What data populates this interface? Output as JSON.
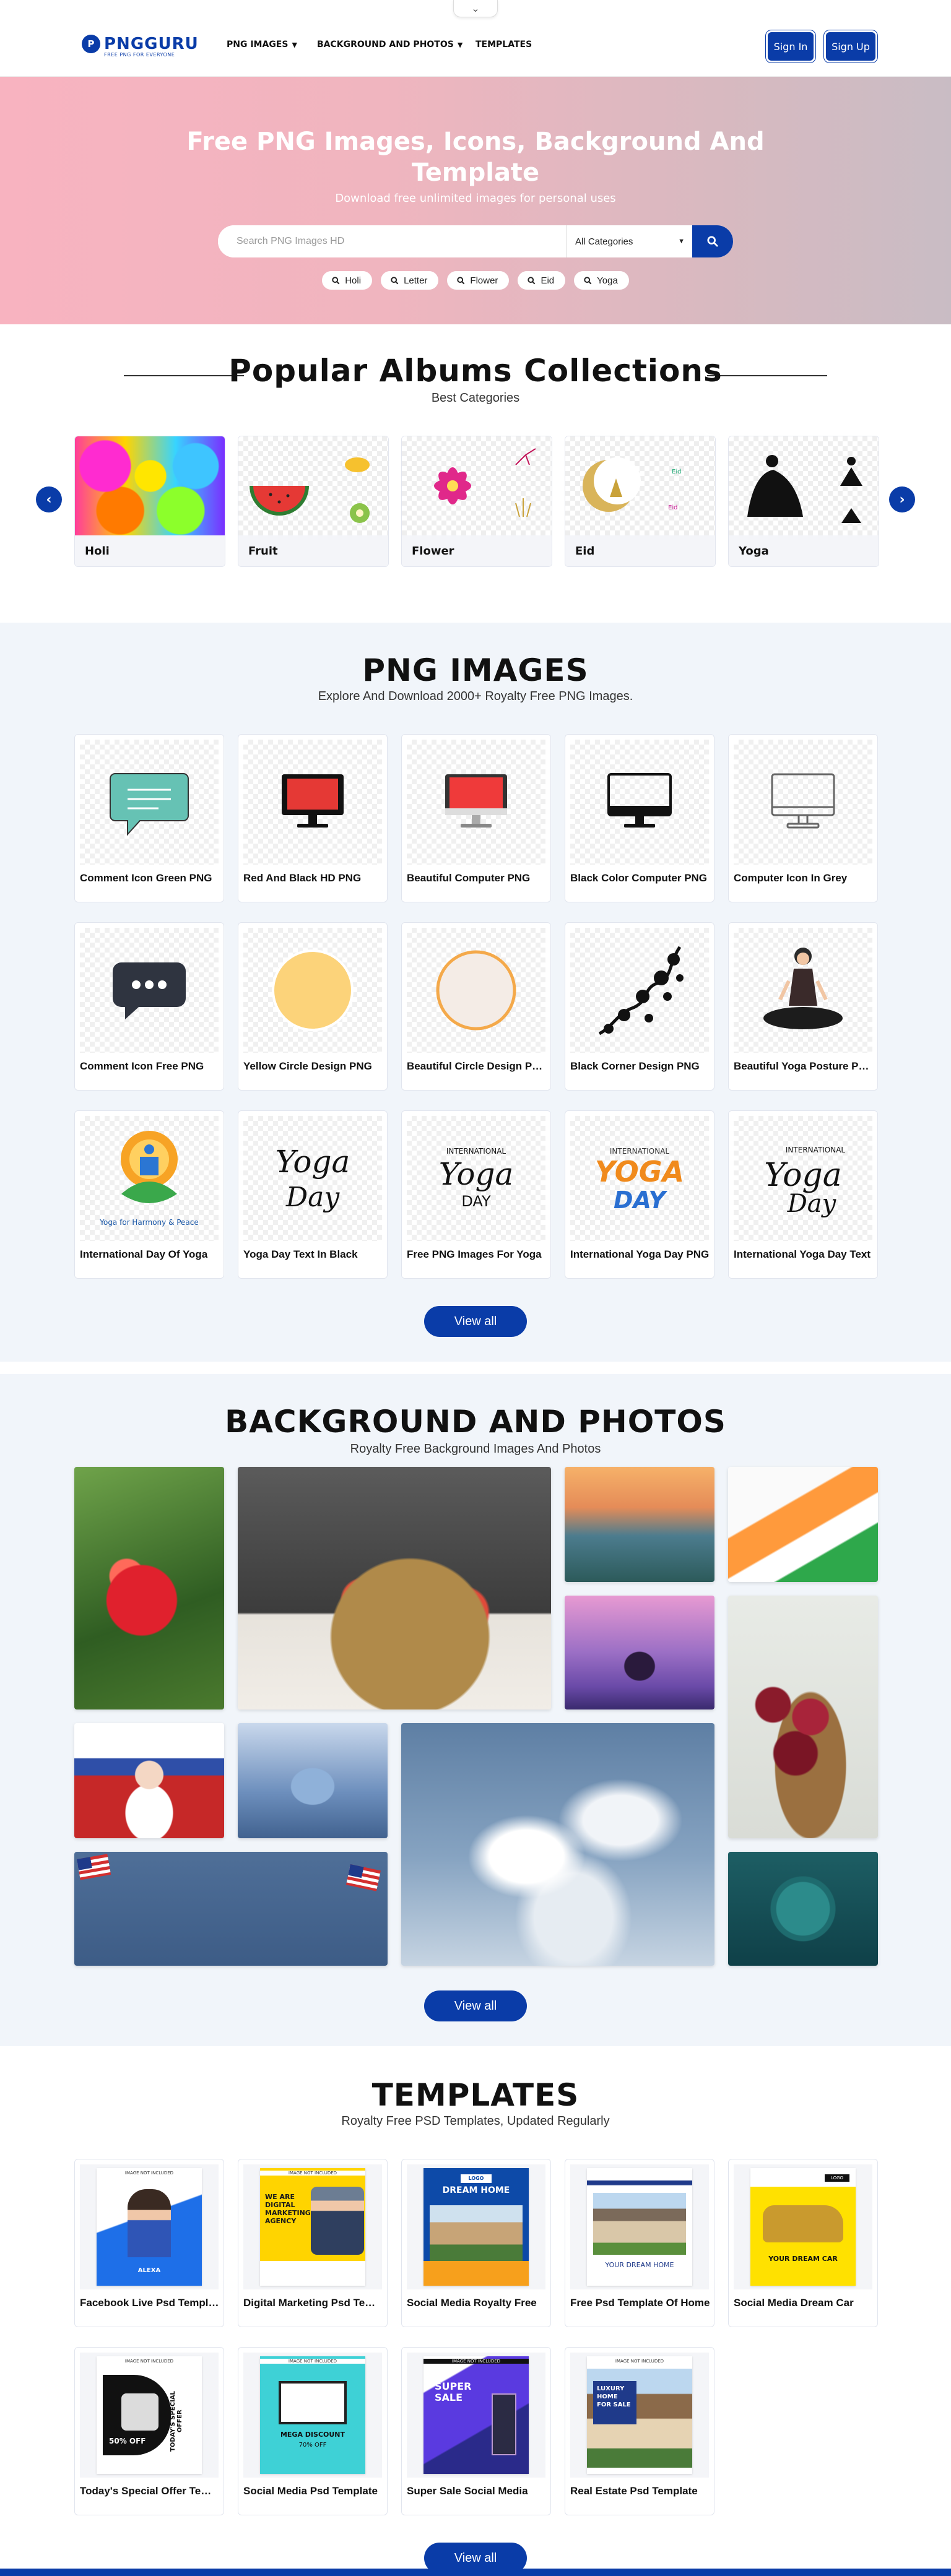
{
  "header": {
    "logo_text": "PNGGURU",
    "logo_mark": "P",
    "logo_tagline": "FREE PNG FOR EVERYONE",
    "nav": [
      {
        "label": "PNG IMAGES",
        "dropdown": true
      },
      {
        "label": "BACKGROUND AND PHOTOS",
        "dropdown": true
      },
      {
        "label": "TEMPLATES",
        "dropdown": false
      }
    ],
    "sign_in": "Sign In",
    "sign_up": "Sign Up"
  },
  "hero": {
    "title": "Free PNG Images, Icons, Background And Template",
    "subtitle": "Download free unlimited images for personal uses",
    "search_placeholder": "Search PNG Images HD",
    "category_selected": "All Categories",
    "chips": [
      "Holi",
      "Letter",
      "Flower",
      "Eid",
      "Yoga"
    ]
  },
  "albums": {
    "title": "Popular Albums Collections",
    "subtitle": "Best Categories",
    "items": [
      "Holi",
      "Fruit",
      "Flower",
      "Eid",
      "Yoga"
    ]
  },
  "png_images": {
    "title": "PNG IMAGES",
    "subtitle": "Explore And Download 2000+ Royalty Free PNG Images.",
    "items": [
      "Comment Icon Green PNG",
      "Red And Black HD PNG",
      "Beautiful Computer PNG",
      "Black Color Computer PNG",
      "Computer Icon In Grey",
      "Comment Icon Free PNG",
      "Yellow Circle Design PNG",
      "Beautiful Circle Design PNG",
      "Black Corner Design PNG",
      "Beautiful Yoga Posture PNG",
      "International Day Of Yoga",
      "Yoga Day Text In Black",
      "Free PNG Images For Yoga",
      "International Yoga Day PNG",
      "International Yoga Day Text"
    ],
    "view_all": "View all"
  },
  "backgrounds": {
    "title": "BACKGROUND AND PHOTOS",
    "subtitle": "Royalty Free Background Images And Photos",
    "view_all": "View all"
  },
  "templates": {
    "title": "TEMPLATES",
    "subtitle": "Royalty Free PSD Templates, Updated Regularly",
    "items": [
      "Facebook Live Psd Template",
      "Digital Marketing Psd Template",
      "Social Media Royalty Free",
      "Free Psd Template Of Home",
      "Social Media Dream Car",
      "Today's Special Offer Template",
      "Social Media Psd Template",
      "Super Sale Social Media",
      "Real Estate Psd Template"
    ],
    "image_not_included": "IMAGE NOT INCLUDED",
    "tpl_texts": {
      "alexa": "ALEXA",
      "agency": "WE ARE DIGITAL MARKETING AGENCY",
      "dream_home": "DREAM HOME",
      "your_dream_home": "YOUR DREAM HOME",
      "your_dream_car": "YOUR DREAM CAR",
      "offer": "50% OFF",
      "special": "TODAY'S SPECIAL OFFER",
      "mega": "MEGA DISCOUNT",
      "mega_pct": "70% OFF",
      "super_sale": "SUPER SALE",
      "luxury": "LUXURY HOME FOR SALE",
      "logo": "LOGO"
    },
    "view_all": "View all"
  },
  "colors": {
    "brand": "#0a3ca8",
    "hero_left": "#f8b3c0",
    "hero_right": "#c9bcc4",
    "section_bg": "#f1f5fa"
  }
}
